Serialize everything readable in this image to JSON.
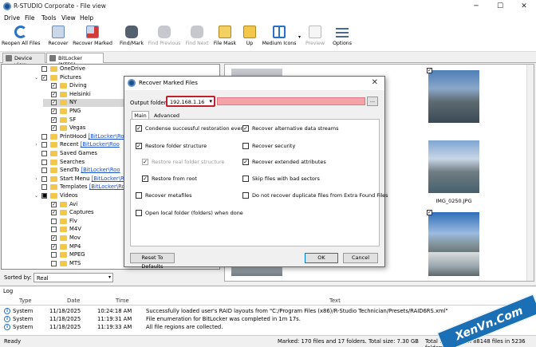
{
  "window": {
    "title": "R-STUDIO Corporate - File view",
    "min": "─",
    "max": "☐",
    "close": "✕"
  },
  "menu": [
    "Drive",
    "File",
    "Tools",
    "View",
    "Help"
  ],
  "toolbar": [
    {
      "label": "Reopen All Files",
      "icon": "reopen-icon",
      "disabled": false
    },
    {
      "label": "Recover",
      "icon": "recover-icon",
      "disabled": false
    },
    {
      "label": "Recover Marked",
      "icon": "recover-marked-icon",
      "disabled": false
    },
    {
      "label": "Find/Mark",
      "icon": "binoculars-icon",
      "disabled": false
    },
    {
      "label": "Find Previous",
      "icon": "find-previous-icon",
      "disabled": true
    },
    {
      "label": "Find Next",
      "icon": "find-next-icon",
      "disabled": true
    },
    {
      "label": "File Mask",
      "icon": "file-mask-icon",
      "disabled": false
    },
    {
      "label": "Up",
      "icon": "folder-up-icon",
      "disabled": false
    },
    {
      "label": "Medium Icons",
      "icon": "medium-icons-icon",
      "disabled": false
    },
    {
      "label": "Preview",
      "icon": "preview-icon",
      "disabled": true
    },
    {
      "label": "Options",
      "icon": "options-icon",
      "disabled": false
    }
  ],
  "tabs": [
    {
      "label": "Device view"
    },
    {
      "label": "BitLocker (NTFS)"
    }
  ],
  "tree": [
    {
      "text": "OneDrive",
      "indent": 0,
      "check": "",
      "expander": ""
    },
    {
      "text": "Pictures",
      "indent": 0,
      "check": "✓",
      "expander": "⌄"
    },
    {
      "text": "Diving",
      "indent": 1,
      "check": "✓",
      "expander": ""
    },
    {
      "text": "Helsinki",
      "indent": 1,
      "check": "✓",
      "expander": ""
    },
    {
      "text": "NY",
      "indent": 1,
      "check": "✓",
      "expander": "",
      "selected": true
    },
    {
      "text": "PNG",
      "indent": 1,
      "check": "✓",
      "expander": ""
    },
    {
      "text": "SF",
      "indent": 1,
      "check": "✓",
      "expander": ""
    },
    {
      "text": "Vegas",
      "indent": 1,
      "check": "✓",
      "expander": ""
    },
    {
      "text": "PrintHood",
      "link": "[BitLocker\\Ro",
      "indent": 0,
      "check": "",
      "expander": ""
    },
    {
      "text": "Recent",
      "link": "[BitLocker\\Roo",
      "indent": 0,
      "check": "",
      "expander": "›"
    },
    {
      "text": "Saved Games",
      "indent": 0,
      "check": "",
      "expander": ""
    },
    {
      "text": "Searches",
      "indent": 0,
      "check": "",
      "expander": ""
    },
    {
      "text": "SendTo",
      "link": "[BitLocker\\Roo",
      "indent": 0,
      "check": "",
      "expander": ""
    },
    {
      "text": "Start Menu",
      "link": "[BitLocker\\R",
      "indent": 0,
      "check": "",
      "expander": "›"
    },
    {
      "text": "Templates",
      "link": "[BitLocker\\Ro",
      "indent": 0,
      "check": "",
      "expander": ""
    },
    {
      "text": "Videos",
      "indent": 0,
      "check": "■",
      "expander": "⌄"
    },
    {
      "text": "Avi",
      "indent": 1,
      "check": "✓",
      "expander": ""
    },
    {
      "text": "Captures",
      "indent": 1,
      "check": "✓",
      "expander": ""
    },
    {
      "text": "Flv",
      "indent": 1,
      "check": "",
      "expander": ""
    },
    {
      "text": "M4V",
      "indent": 1,
      "check": "",
      "expander": ""
    },
    {
      "text": "Mov",
      "indent": 1,
      "check": "✓",
      "expander": ""
    },
    {
      "text": "MP4",
      "indent": 1,
      "check": "✓",
      "expander": ""
    },
    {
      "text": "MPEG",
      "indent": 1,
      "check": "",
      "expander": ""
    },
    {
      "text": "MTS",
      "indent": 1,
      "check": "",
      "expander": ""
    }
  ],
  "thumbs": [
    {
      "caption": "",
      "checked": false
    },
    {
      "caption": "",
      "checked": true
    },
    {
      "caption": "JPG",
      "checked": false
    },
    {
      "caption": "IMG_0250.JPG",
      "checked": false
    },
    {
      "caption": "JPG",
      "checked": false
    },
    {
      "caption": "IMG_0390.JPG",
      "checked": true
    },
    {
      "caption": "",
      "checked": false
    },
    {
      "caption": "",
      "checked": false
    }
  ],
  "sort": {
    "label": "Sorted by:",
    "value": "Real"
  },
  "log": {
    "title": "Log",
    "headers": [
      "Type",
      "Date",
      "Time",
      "Text"
    ],
    "rows": [
      {
        "type": "System",
        "date": "11/18/2025",
        "time": "10:24:18 AM",
        "text": "Successfully loaded user's RAID layouts from \"C:/Program Files (x86)/R-Studio Technician/Presets/RAID6RS.xml\""
      },
      {
        "type": "System",
        "date": "11/18/2025",
        "time": "11:19:31 AM",
        "text": "File enumeration for BitLocker was completed in 1m 17s."
      },
      {
        "type": "System",
        "date": "11/18/2025",
        "time": "11:19:33 AM",
        "text": "All file regions are collected."
      }
    ]
  },
  "status": {
    "ready": "Ready",
    "marked": "Marked: 170 files and 17 folders. Total size: 7.30 GB",
    "total": "Total 73.78 GB in 88148 files in 5236 folders"
  },
  "dialog": {
    "title": "Recover Marked Files",
    "output_label": "Output folder:",
    "output_value": "192.168.1.16",
    "browse": "...",
    "tabs": [
      "Main",
      "Advanced"
    ],
    "left": [
      {
        "label": "Condense successful restoration events",
        "checked": true,
        "disabled": false
      },
      {
        "label": "Restore folder structure",
        "checked": true,
        "disabled": false
      },
      {
        "label": "Restore real folder structure",
        "checked": true,
        "disabled": true
      },
      {
        "label": "Restore from root",
        "checked": true,
        "disabled": false
      },
      {
        "label": "Recover metafiles",
        "checked": false,
        "disabled": false
      },
      {
        "label": "Open local folder (folders) when done",
        "checked": false,
        "disabled": false
      }
    ],
    "right": [
      {
        "label": "Recover alternative data streams",
        "checked": true,
        "disabled": false
      },
      {
        "label": "Recover security",
        "checked": false,
        "disabled": false
      },
      {
        "label": "Recover extended attributes",
        "checked": true,
        "disabled": false
      },
      {
        "label": "Skip files with bad sectors",
        "checked": false,
        "disabled": false
      },
      {
        "label": "Do not recover duplicate files from Extra Found Files",
        "checked": false,
        "disabled": false
      }
    ],
    "reset": "Reset To Defaults",
    "ok": "OK",
    "cancel": "Cancel"
  },
  "watermark": "XenVn.Com",
  "colors": {
    "accent": "#0078d7",
    "highlight_red": "#c0202a",
    "output_fill": "#f4a4a8",
    "link": "#1a4fd0"
  }
}
